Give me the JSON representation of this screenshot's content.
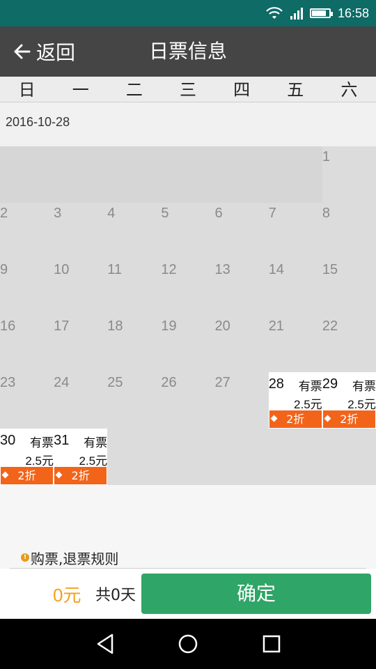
{
  "status": {
    "time": "16:58",
    "battery_level": 0.85
  },
  "header": {
    "back_label": "返回",
    "title": "日票信息"
  },
  "weekdays": [
    "日",
    "一",
    "二",
    "三",
    "四",
    "五",
    "六"
  ],
  "month_label": "2016-10-28",
  "calendar": {
    "days": [
      "1",
      "2",
      "3",
      "4",
      "5",
      "6",
      "7",
      "8",
      "9",
      "10",
      "11",
      "12",
      "13",
      "14",
      "15",
      "16",
      "17",
      "18",
      "19",
      "20",
      "21",
      "22",
      "23",
      "24",
      "25",
      "26",
      "27",
      "28",
      "29",
      "30",
      "31"
    ],
    "tickets": [
      {
        "day": "28",
        "stock": "有票",
        "price": "2.5元",
        "discount": "2折"
      },
      {
        "day": "29",
        "stock": "有票",
        "price": "2.5元",
        "discount": "2折"
      },
      {
        "day": "30",
        "stock": "有票",
        "price": "2.5元",
        "discount": "2折"
      },
      {
        "day": "31",
        "stock": "有票",
        "price": "2.5元",
        "discount": "2折"
      }
    ]
  },
  "footer": {
    "rules_label": "购票,退票规则",
    "total_price": "0元",
    "total_days": "共0天",
    "confirm_label": "确定"
  },
  "colors": {
    "accent_orange": "#f2641a",
    "confirm_green": "#2fa567",
    "price_orange": "#f5a01c",
    "statusbar": "#0e6b66",
    "titlebar": "#454545"
  }
}
